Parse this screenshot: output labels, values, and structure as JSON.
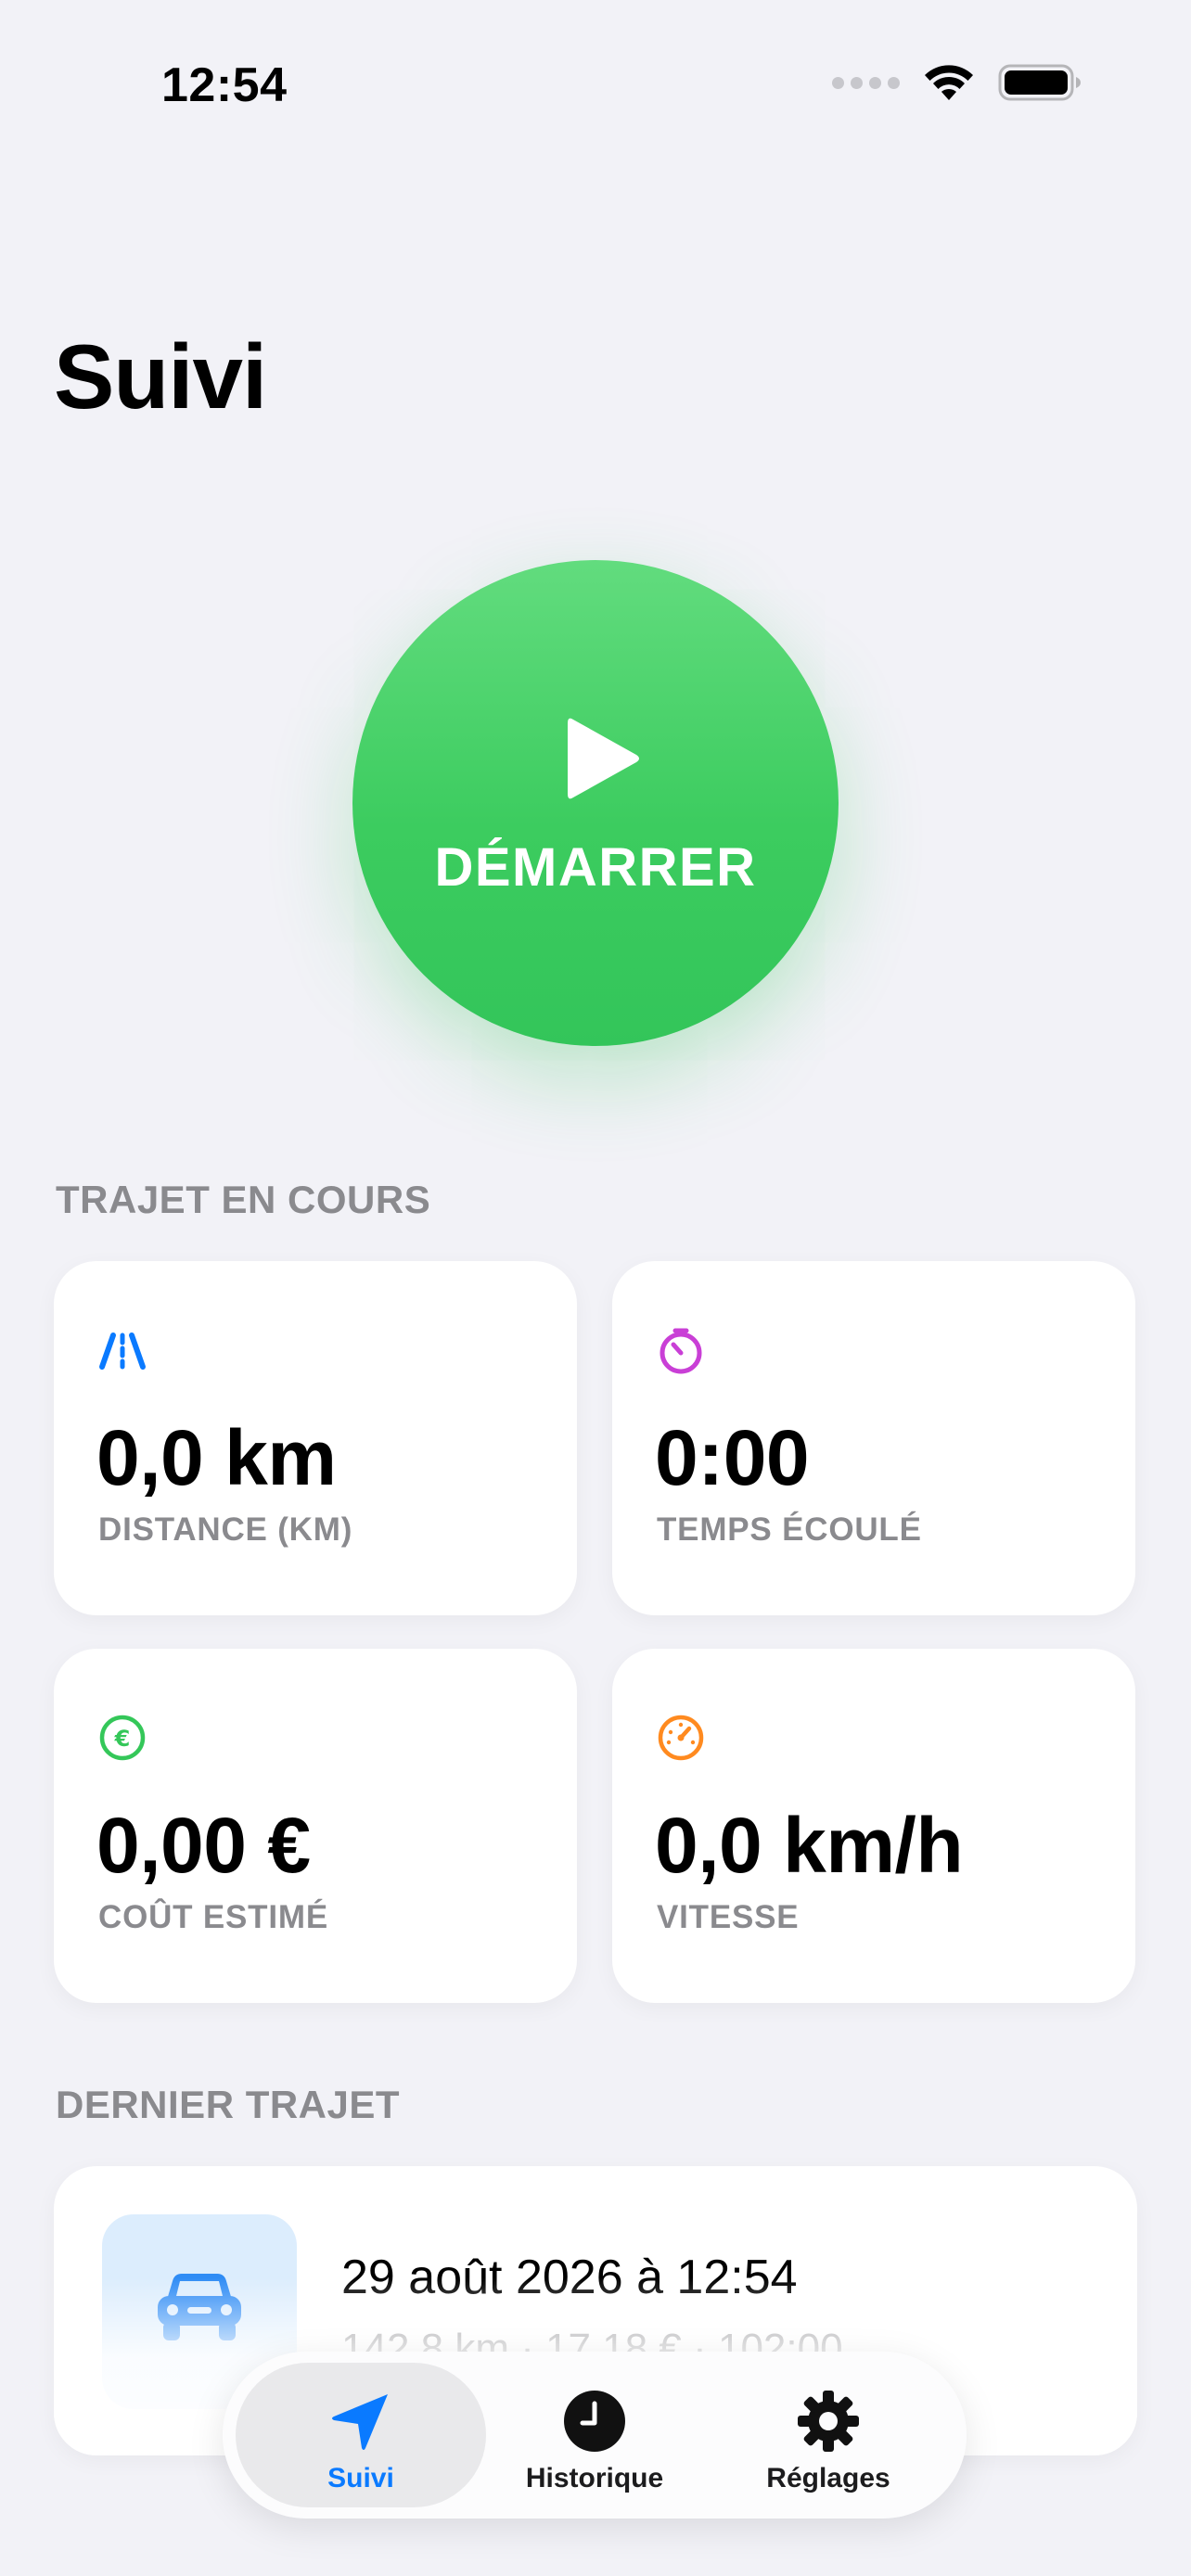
{
  "status_bar": {
    "time": "12:54",
    "icons": [
      "cellular-signal-icon",
      "wifi-icon",
      "battery-icon"
    ]
  },
  "header": {
    "title": "Suivi"
  },
  "start_button": {
    "label": "DÉMARRER",
    "icon": "play-icon",
    "color": "#34c759"
  },
  "current_trip": {
    "section_title": "TRAJET EN COURS",
    "stats": [
      {
        "value": "0,0 km",
        "label": "DISTANCE (KM)",
        "icon": "road-icon",
        "color": "#0a7aff"
      },
      {
        "value": "0:00",
        "label": "TEMPS ÉCOULÉ",
        "icon": "timer-icon",
        "color": "#c93fd6"
      },
      {
        "value": "0,00 €",
        "label": "COÛT ESTIMÉ",
        "icon": "euro-circle-icon",
        "color": "#34c759"
      },
      {
        "value": "0,0 km/h",
        "label": "VITESSE",
        "icon": "speedometer-icon",
        "color": "#ff8a1f"
      }
    ]
  },
  "last_trip": {
    "section_title": "DERNIER TRAJET",
    "date": "29 août 2026 à 12:54",
    "summary": "142,8 km · 17,18 € · 102:00",
    "icon": "car-icon",
    "icon_color": "#2f8cf5"
  },
  "tab_bar": {
    "tabs": [
      {
        "label": "Suivi",
        "icon": "location-arrow-icon",
        "active": true
      },
      {
        "label": "Historique",
        "icon": "clock-icon",
        "active": false
      },
      {
        "label": "Réglages",
        "icon": "gear-icon",
        "active": false
      }
    ],
    "active_color": "#0a7aff"
  }
}
